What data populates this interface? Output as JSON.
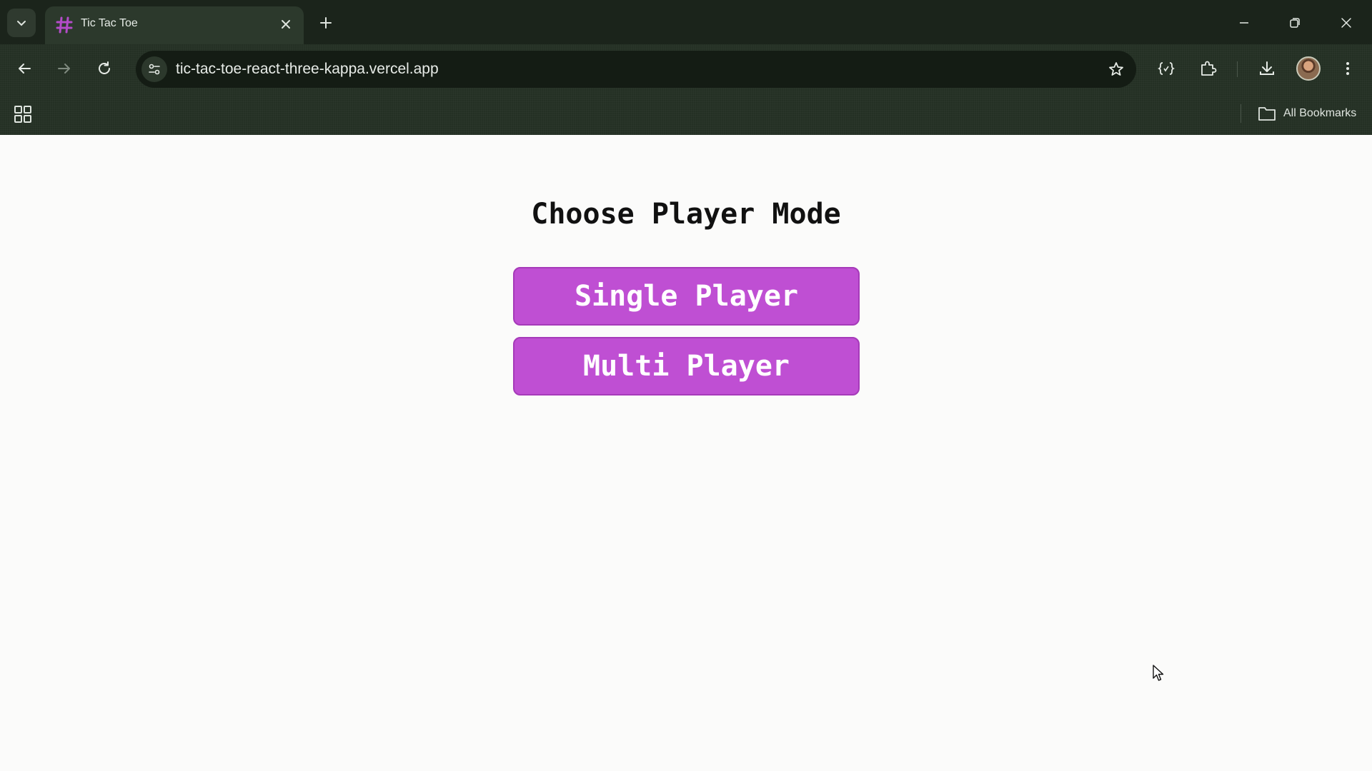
{
  "browser": {
    "tab": {
      "title": "Tic Tac Toe"
    },
    "address_bar": {
      "url": "tic-tac-toe-react-three-kappa.vercel.app"
    },
    "bookmarks_bar": {
      "all_bookmarks_label": "All Bookmarks"
    },
    "icons": {
      "tab_search": "chevron-down-icon",
      "favicon": "hash-icon",
      "tab_close": "close-icon",
      "new_tab": "plus-icon",
      "minimize": "minimize-icon",
      "restore": "restore-icon",
      "close_window": "close-icon",
      "back": "arrow-left-icon",
      "forward": "arrow-right-icon",
      "reload": "reload-icon",
      "site_info": "tune-icon",
      "bookmark_star": "star-icon",
      "extension_dev": "braces-icon",
      "extensions": "puzzle-icon",
      "downloads": "download-icon",
      "menu": "kebab-menu-icon",
      "apps": "apps-grid-icon",
      "folder": "folder-icon"
    }
  },
  "page": {
    "title": "Choose Player Mode",
    "buttons": {
      "single": "Single Player",
      "multi": "Multi Player"
    }
  },
  "colors": {
    "chrome_bg": "#243024",
    "tabstrip_bg": "#1b241b",
    "button_bg": "#bf4fd3",
    "page_bg": "#fbfbfa",
    "favicon": "#b44cc9"
  }
}
